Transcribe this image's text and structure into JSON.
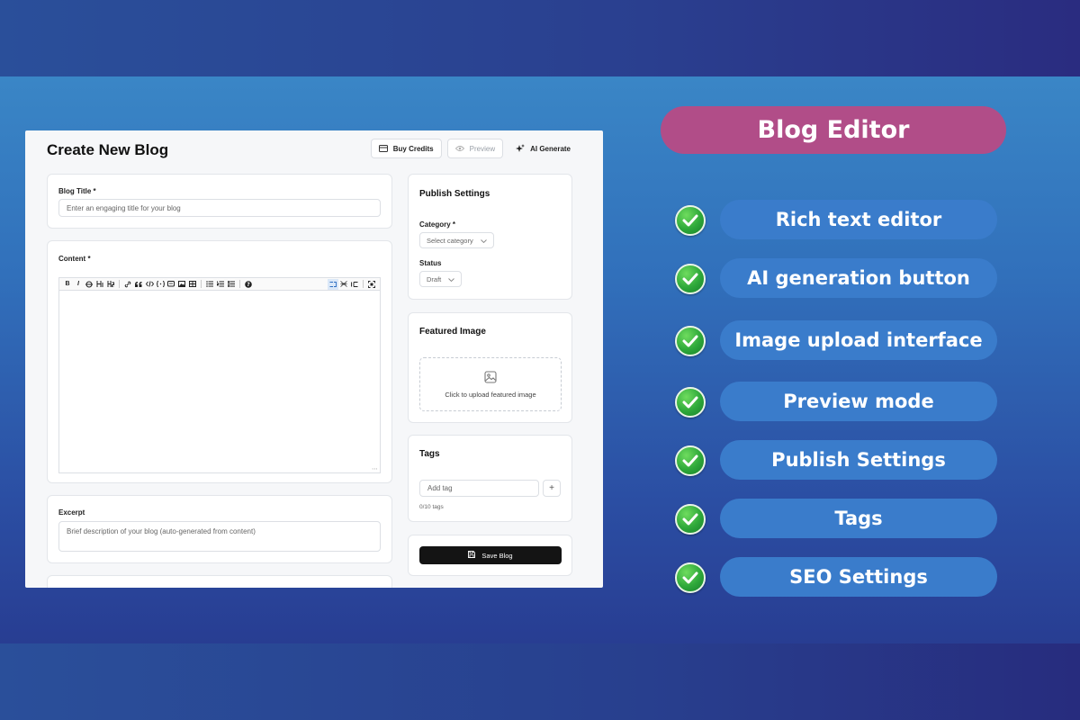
{
  "header": {
    "title": "Create New Blog"
  },
  "actions": {
    "buy_credits": "Buy Credits",
    "preview": "Preview",
    "ai_generate": "AI Generate"
  },
  "form": {
    "title_label": "Blog Title *",
    "title_placeholder": "Enter an engaging title for your blog",
    "content_label": "Content *",
    "excerpt_label": "Excerpt",
    "excerpt_placeholder": "Brief description of your blog (auto-generated from content)"
  },
  "toolbar": {
    "bold": "B",
    "italic": "I"
  },
  "publish": {
    "title": "Publish Settings",
    "category_label": "Category *",
    "category_value": "Select category",
    "status_label": "Status",
    "status_value": "Draft"
  },
  "featured": {
    "title": "Featured Image",
    "upload_text": "Click to upload featured image"
  },
  "tags": {
    "title": "Tags",
    "placeholder": "Add tag",
    "add": "+",
    "count": "0/10 tags"
  },
  "save": {
    "label": "Save Blog"
  },
  "features": {
    "heading": "Blog Editor",
    "items": [
      "Rich text editor",
      "AI generation button",
      "Image upload interface",
      "Preview mode",
      "Publish Settings",
      "Tags",
      "SEO Settings"
    ]
  },
  "colors": {
    "heading_pill": "#b14d88",
    "feature_pill": "#3a7ccb",
    "check": "#2ea83a",
    "save_button": "#141414"
  }
}
